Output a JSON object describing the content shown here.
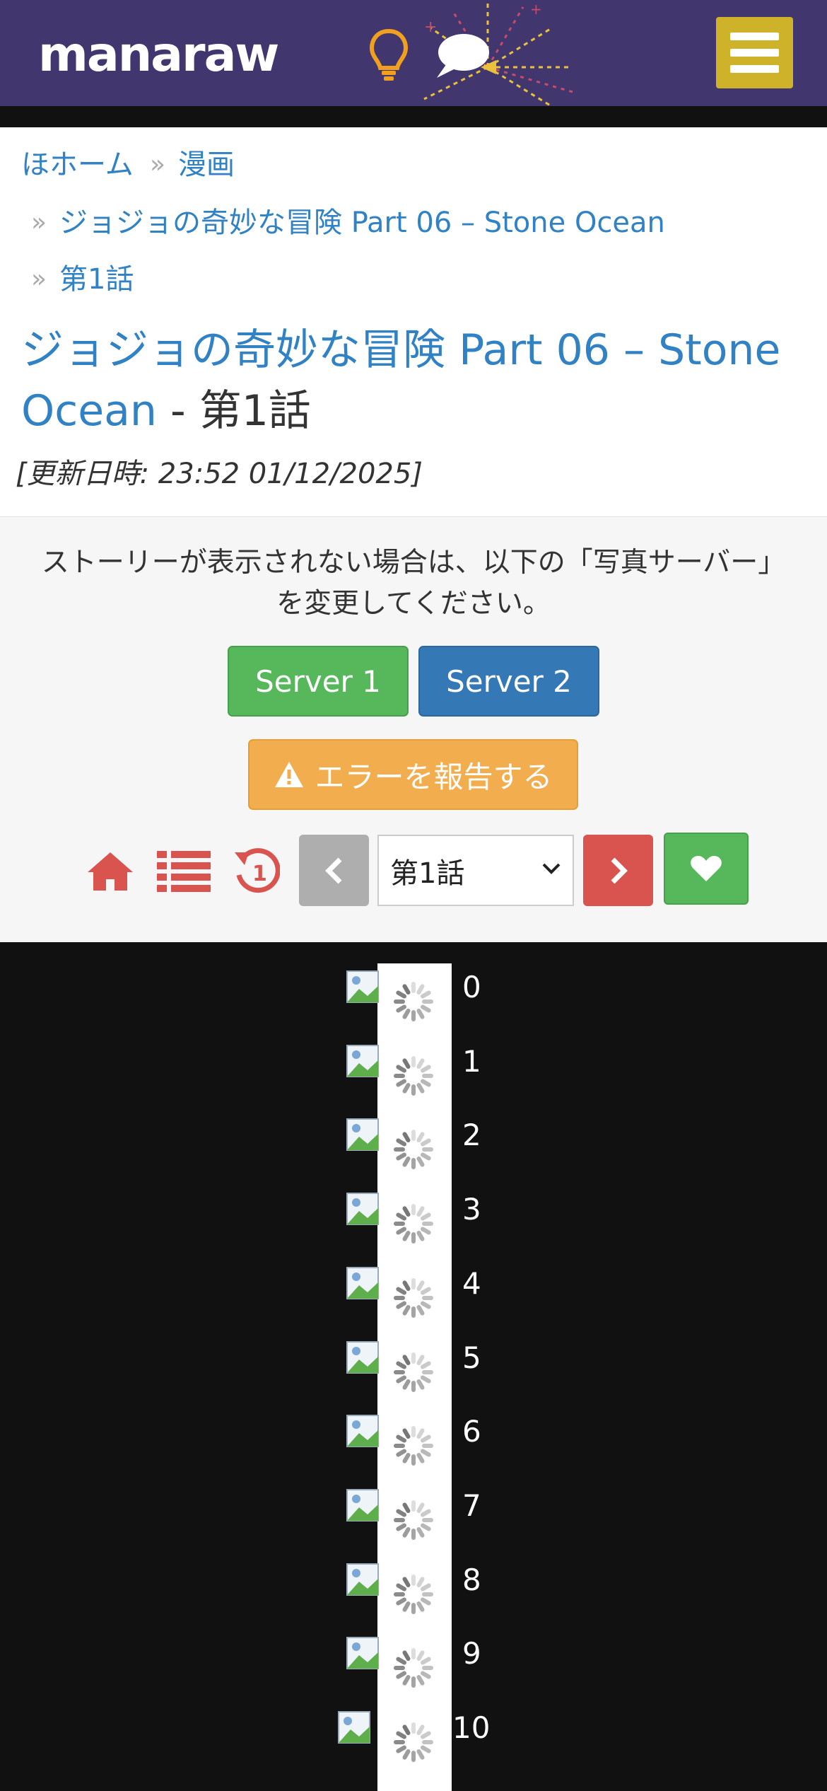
{
  "header": {
    "logo": "manaraw"
  },
  "breadcrumb": {
    "home": "ほホーム",
    "category": "漫画",
    "series": "ジョジョの奇妙な冒険 Part 06 – Stone Ocean",
    "chapter": "第1話"
  },
  "page_title": {
    "series": "ジョジョの奇妙な冒険 Part 06 – Stone Ocean",
    "separator": " - ",
    "chapter": "第1話"
  },
  "updated": "[更新日時: 23:52 01/12/2025]",
  "notice": "ストーリーが表示されない場合は、以下の「写真サーバー」を変更してください。",
  "servers": {
    "server1_label": "Server 1",
    "server2_label": "Server 2"
  },
  "report_label": "エラーを報告する",
  "chapter_nav": {
    "selected": "第1話"
  },
  "reader": {
    "pages": [
      "0",
      "1",
      "2",
      "3",
      "4",
      "5",
      "6",
      "7",
      "8",
      "9",
      "10"
    ]
  },
  "colors": {
    "header_bg": "#41366e",
    "menu_button": "#ceb32a",
    "link": "#3182c4",
    "server1": "#56b85a",
    "server2": "#3478b6",
    "report": "#f1ad4e",
    "danger": "#d9534f"
  },
  "icons": [
    "lightbulb-icon",
    "chat-bubble-icon",
    "hamburger-icon",
    "warning-icon",
    "home-icon",
    "list-icon",
    "history-icon",
    "chevron-left-icon",
    "chevron-right-icon",
    "heart-icon",
    "chevron-down-icon",
    "broken-image-icon",
    "spinner-icon"
  ]
}
